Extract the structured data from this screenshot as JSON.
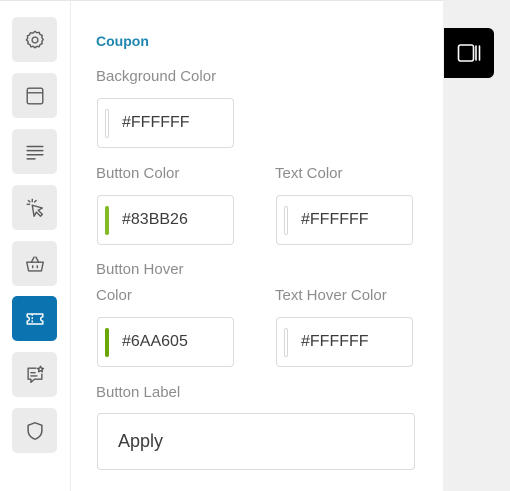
{
  "sidebar": {
    "items": [
      {
        "name": "settings-gear",
        "icon": "gear-icon"
      },
      {
        "name": "window",
        "icon": "window-icon"
      },
      {
        "name": "lines",
        "icon": "lines-icon"
      },
      {
        "name": "click",
        "icon": "pointer-click-icon"
      },
      {
        "name": "basket",
        "icon": "basket-icon"
      },
      {
        "name": "coupon",
        "icon": "ticket-icon",
        "active": true
      },
      {
        "name": "reviews",
        "icon": "chat-star-icon"
      },
      {
        "name": "security",
        "icon": "shield-icon"
      }
    ]
  },
  "section": {
    "title": "Coupon"
  },
  "fields": {
    "background_color": {
      "label": "Background Color",
      "value": "#FFFFFF"
    },
    "button_color": {
      "label": "Button Color",
      "value": "#83BB26"
    },
    "text_color": {
      "label": "Text Color",
      "value": "#FFFFFF"
    },
    "button_hover_color": {
      "label_line1": "Button Hover",
      "label_line2": "Color",
      "value": "#6AA605"
    },
    "text_hover_color": {
      "label": "Text Hover Color",
      "value": "#FFFFFF"
    },
    "button_label": {
      "label": "Button Label",
      "value": "Apply"
    }
  },
  "preview_toggle": {
    "icon": "panel-toggle-icon"
  },
  "colors": {
    "accent": "#0a73b0",
    "heading": "#1d86b0",
    "button_swatch": "#83BB26",
    "hover_swatch": "#6AA605"
  }
}
